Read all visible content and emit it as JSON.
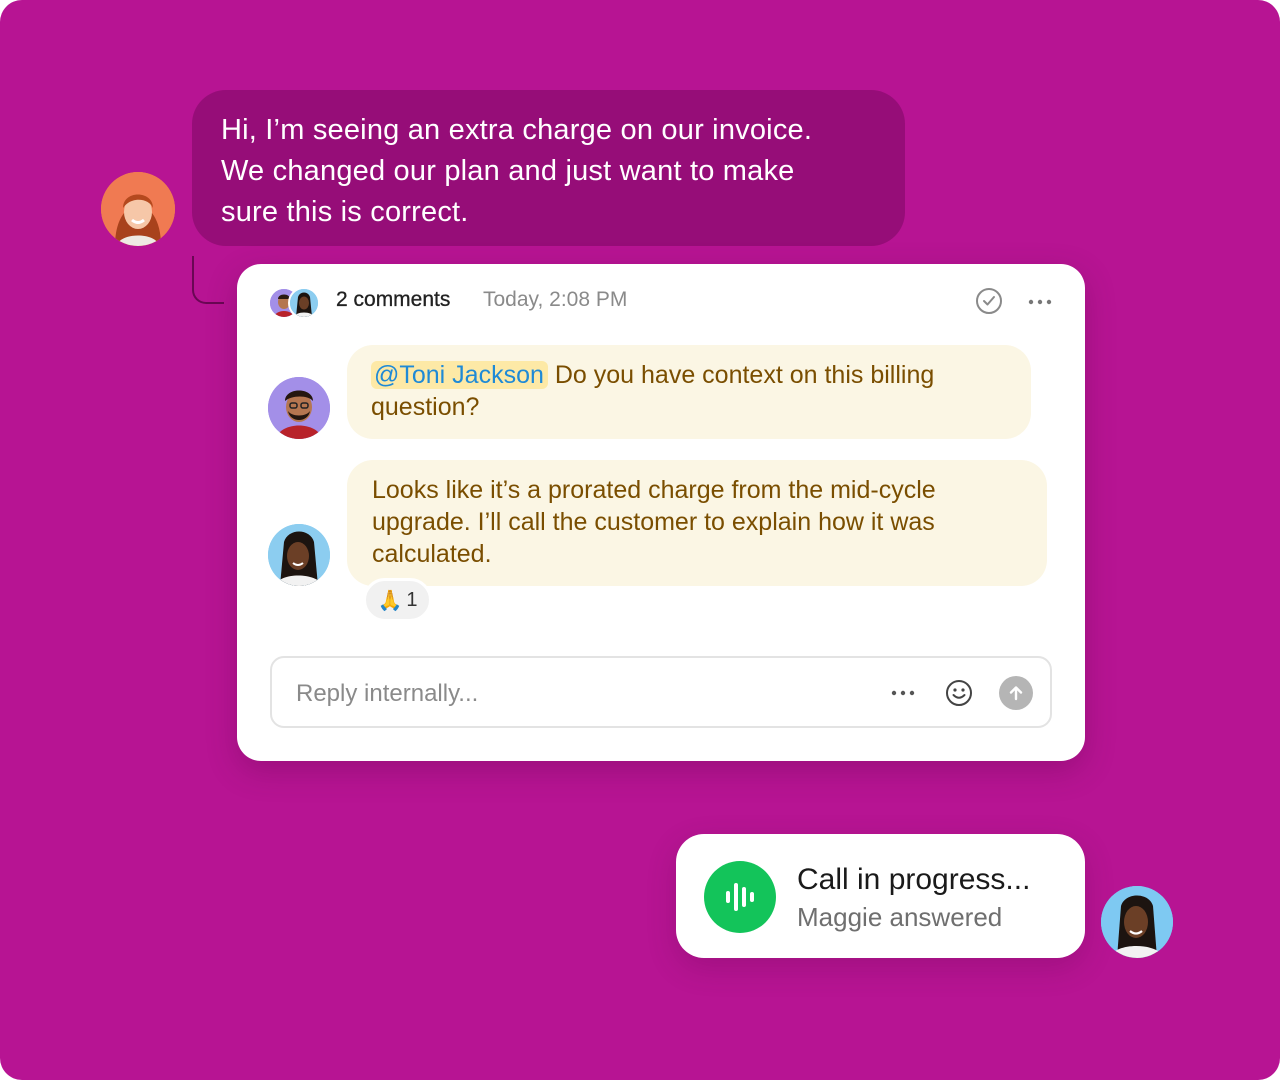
{
  "customer_message": {
    "lines": [
      "Hi, I’m seeing an extra charge on our invoice.",
      "We changed our plan and just want to make",
      "sure this is correct."
    ]
  },
  "thread": {
    "comment_count": "2 comments",
    "timestamp": "Today, 2:08 PM",
    "resolve_icon": "check-circle-icon",
    "more_icon": "ellipsis-icon",
    "comments": [
      {
        "mention": "@Toni Jackson",
        "line1_rest": "Do you have context on this billing",
        "line2": "question?"
      },
      {
        "lines": [
          "Looks like it’s a prorated charge from the mid-cycle",
          "upgrade. I’ll call the customer to explain how it was",
          "calculated."
        ],
        "reaction_emoji": "🙏",
        "reaction_count": "1"
      }
    ],
    "reply": {
      "placeholder": "Reply internally..."
    }
  },
  "call": {
    "title": "Call in progress...",
    "subtitle": "Maggie answered"
  },
  "colors": {
    "background": "#b71493",
    "customer_bubble": "#960d78",
    "comment_bubble": "#fbf6e4",
    "comment_text": "#7a4e00",
    "mention_text": "#1f8ad6",
    "call_green": "#13c45a"
  }
}
